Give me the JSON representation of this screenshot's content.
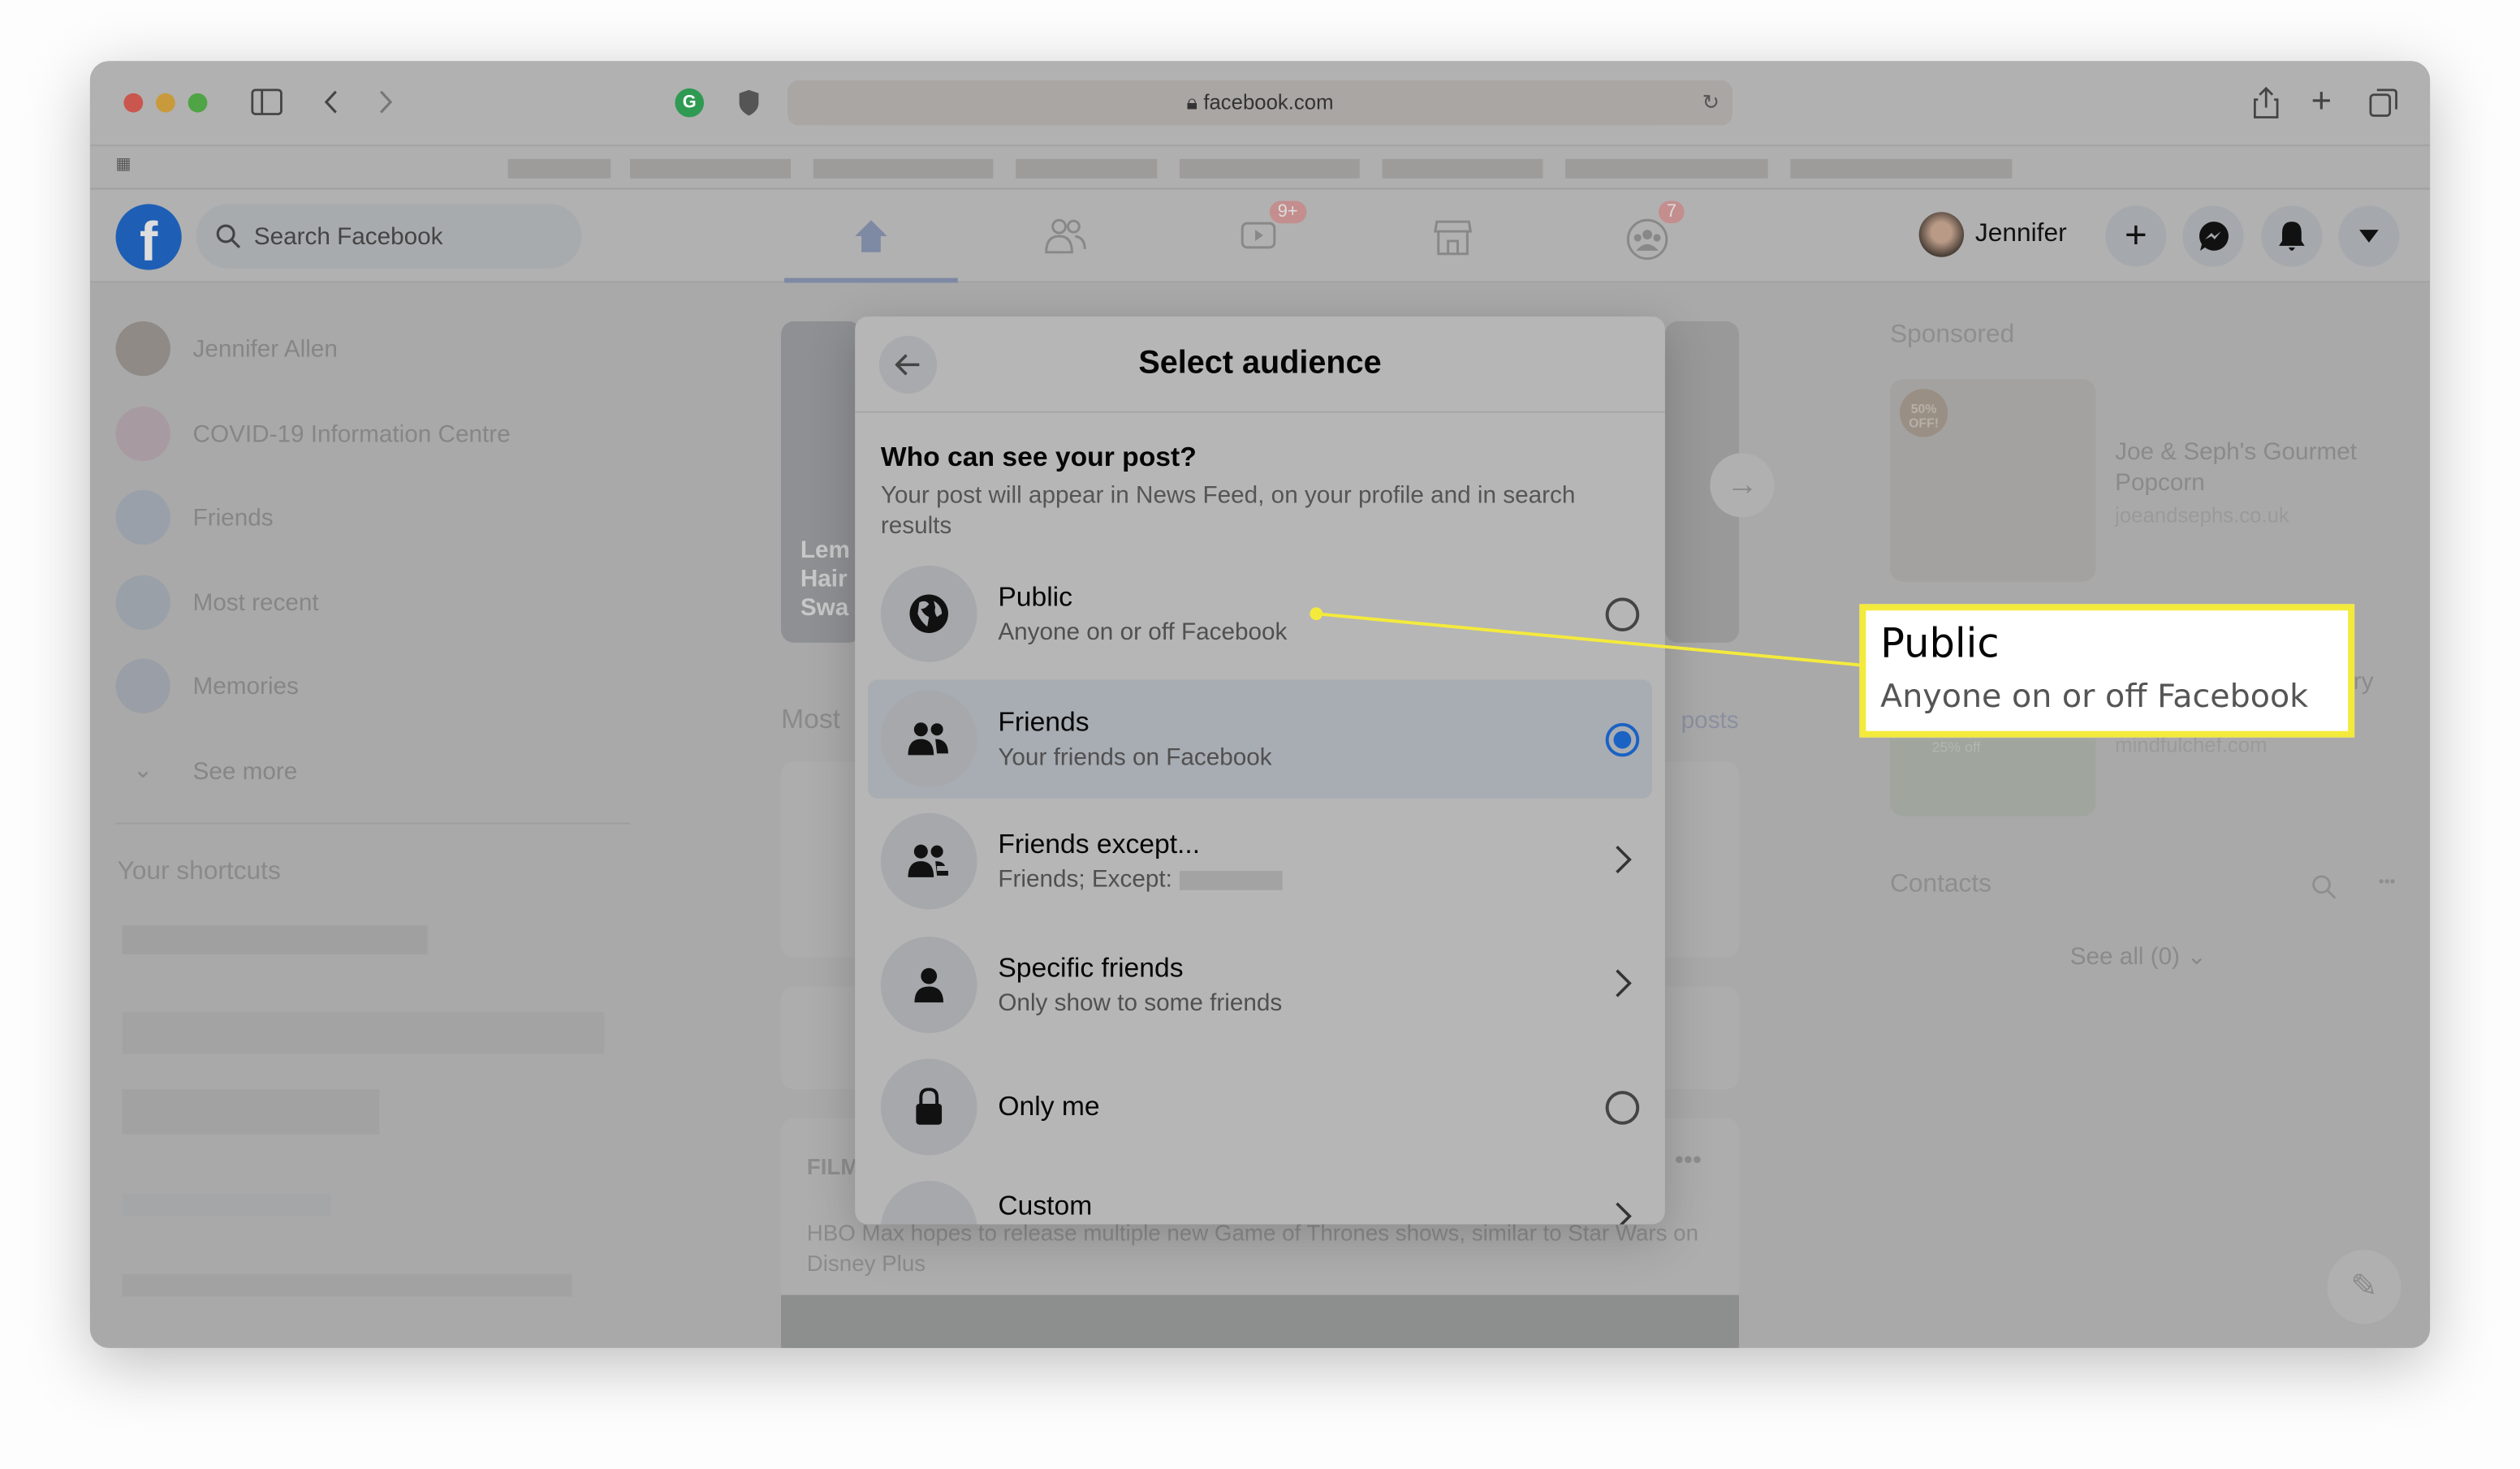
{
  "browser": {
    "url": "facebook.com",
    "traffic_lights": [
      "#d9534a",
      "#d9a23a",
      "#5bb24a"
    ]
  },
  "header": {
    "search_placeholder": "Search Facebook",
    "user_name": "Jennifer",
    "badges": {
      "watch": "9+",
      "groups": "7"
    },
    "brand_color": "#1877f2"
  },
  "sidebar": {
    "items": [
      {
        "label": "Jennifer Allen",
        "icon": "avatar"
      },
      {
        "label": "COVID-19 Information Centre",
        "icon": "heart-shield-icon"
      },
      {
        "label": "Friends",
        "icon": "friends-icon"
      },
      {
        "label": "Most recent",
        "icon": "clock-icon"
      },
      {
        "label": "Memories",
        "icon": "memories-icon"
      },
      {
        "label": "See more",
        "icon": "chevron-down-icon"
      }
    ],
    "shortcuts_title": "Your shortcuts"
  },
  "feed": {
    "most_label": "Most",
    "posts_label": "posts",
    "story_snippet": [
      "Lem",
      "Hair",
      "Swa"
    ],
    "article_text": "HBO Max hopes to release multiple new Game of Thrones shows, similar to Star Wars on Disney Plus",
    "publisher": "FILM"
  },
  "right": {
    "sponsored": "Sponsored",
    "ads": [
      {
        "title": "Joe & Seph's Gourmet Popcorn",
        "domain": "joeandsephs.co.uk",
        "badge": "50% OFF!"
      },
      {
        "title": "ary",
        "domain": "mindfulchef.com",
        "badge": "25% off"
      }
    ],
    "contacts": "Contacts",
    "see_all": "See all (0)"
  },
  "dialog": {
    "title": "Select audience",
    "question": "Who can see your post?",
    "description": "Your post will appear in News Feed, on your profile and in search results",
    "selected_color": "#1877f2",
    "options": [
      {
        "title": "Public",
        "subtitle": "Anyone on or off Facebook",
        "control": "radio",
        "selected": false,
        "icon": "globe-icon"
      },
      {
        "title": "Friends",
        "subtitle": "Your friends on Facebook",
        "control": "radio",
        "selected": true,
        "icon": "friends-icon"
      },
      {
        "title": "Friends except...",
        "subtitle": "Friends; Except:",
        "control": "chevron",
        "icon": "friends-except-icon"
      },
      {
        "title": "Specific friends",
        "subtitle": "Only show to some friends",
        "control": "chevron",
        "icon": "person-icon"
      },
      {
        "title": "Only me",
        "subtitle": "",
        "control": "radio",
        "selected": false,
        "icon": "lock-icon"
      },
      {
        "title": "Custom",
        "subtitle": "",
        "control": "chevron",
        "icon": "custom-icon"
      }
    ]
  },
  "callout": {
    "title": "Public",
    "subtitle": "Anyone on or off Facebook",
    "border_color": "#f4ea3c"
  }
}
